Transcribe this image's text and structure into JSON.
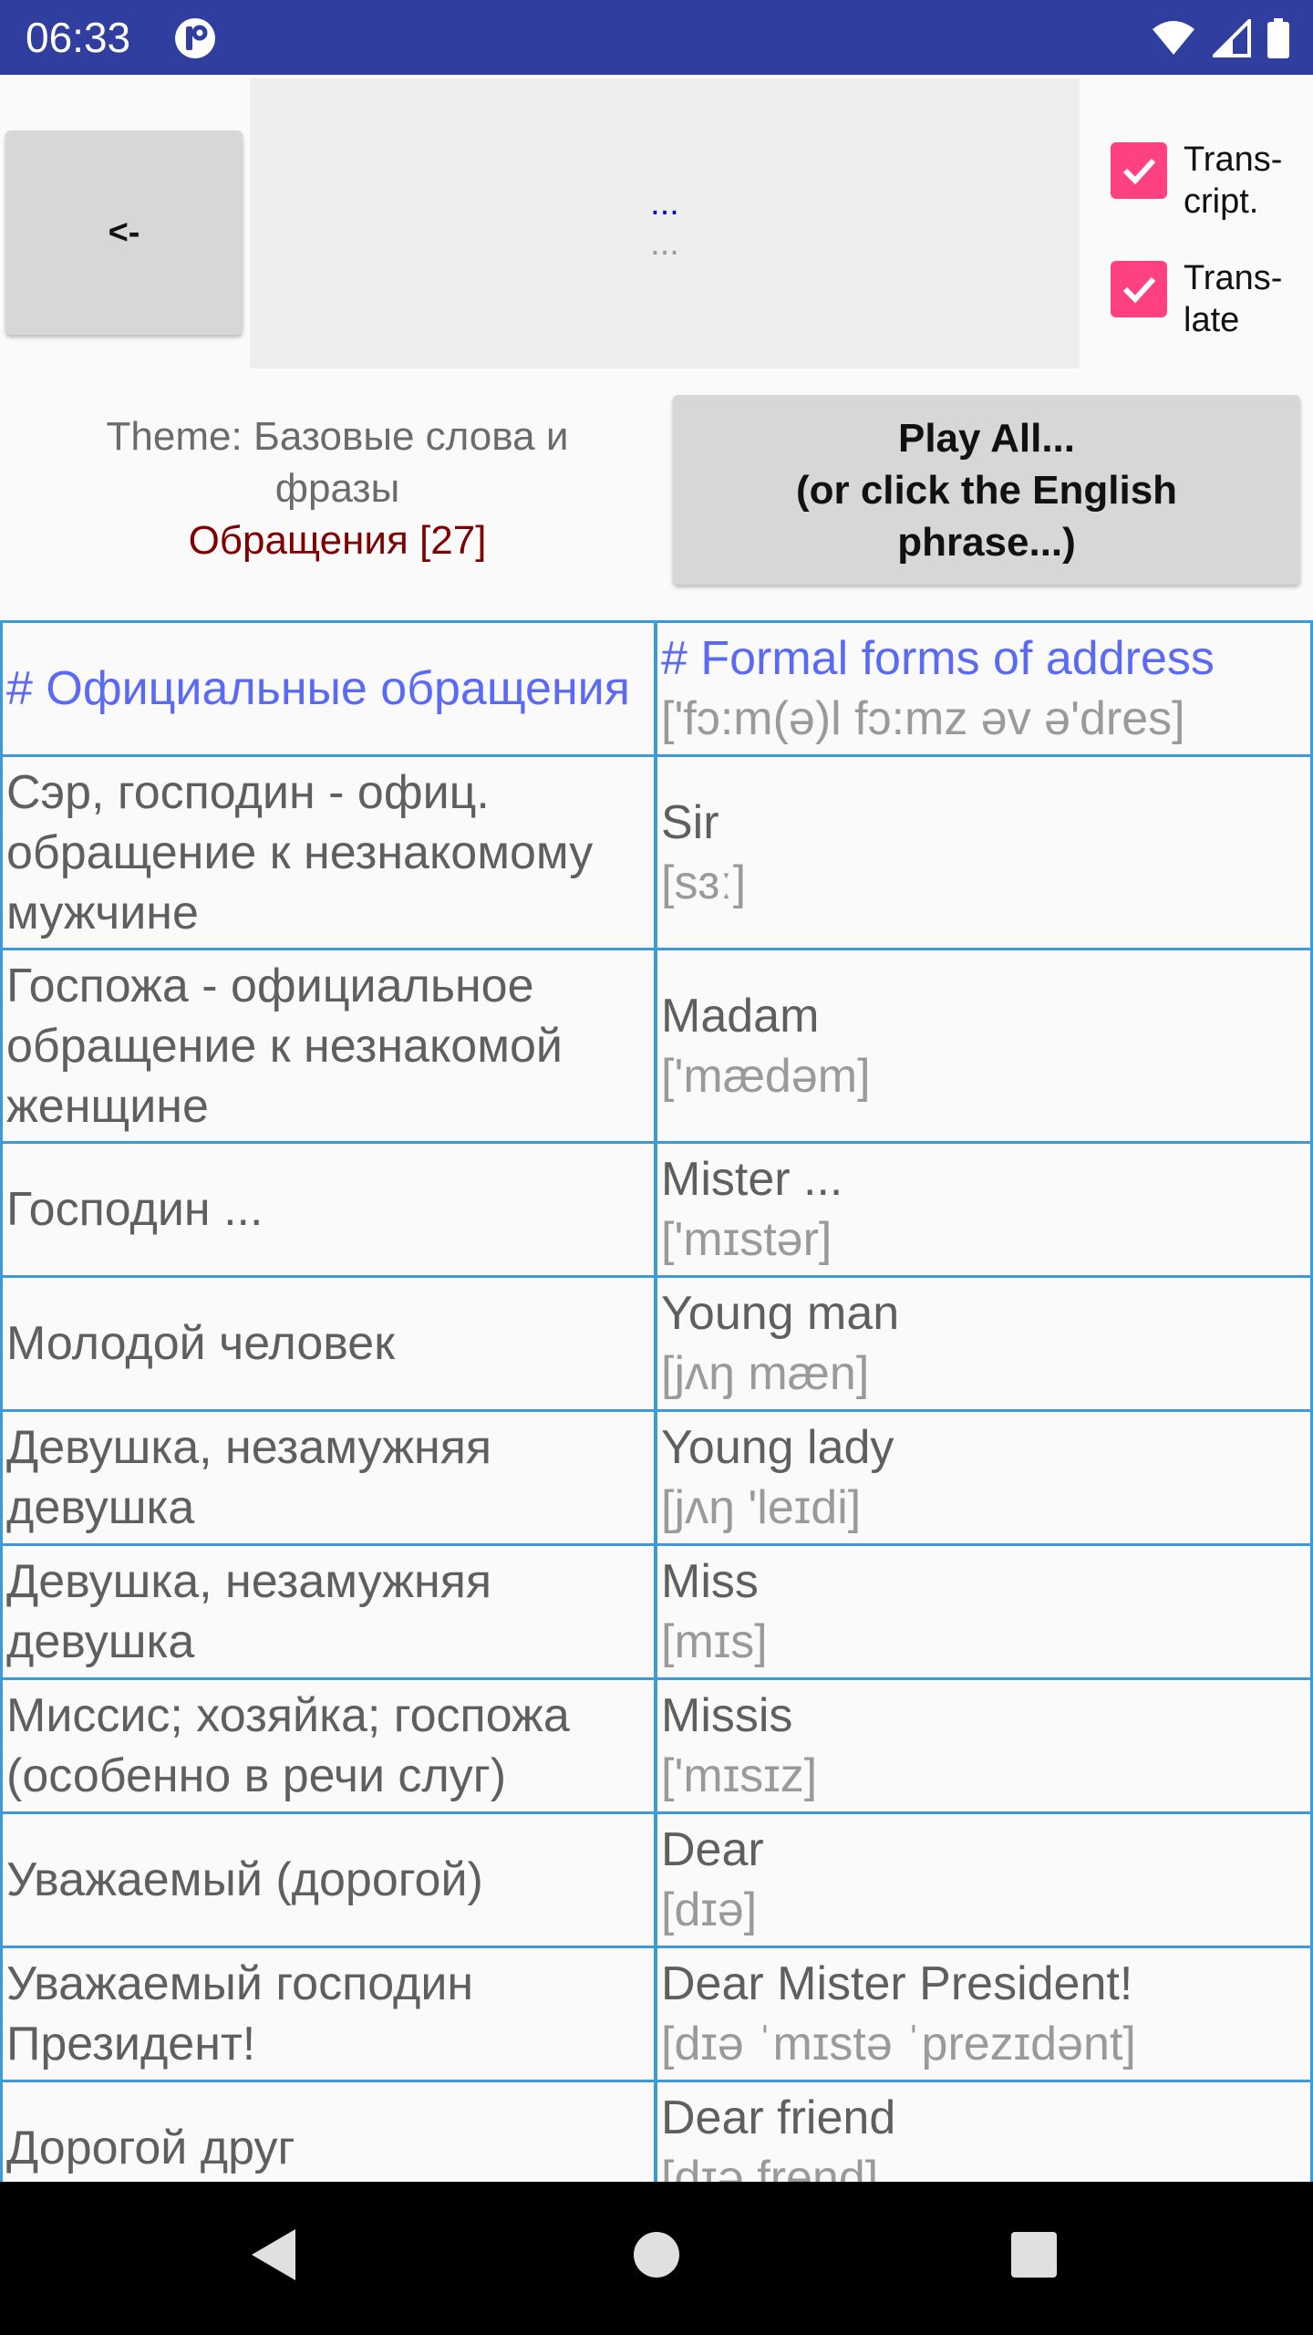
{
  "status_bar": {
    "time": "06:33",
    "icons": [
      "app-notification-icon",
      "wifi-icon",
      "signal-icon",
      "battery-icon"
    ]
  },
  "controls": {
    "back_label": "<-",
    "current_phrase": "...",
    "current_transcription": "...",
    "transcript_label": "Trans-\ncript.",
    "translate_label": "Trans-\nlate",
    "transcript_checked": true,
    "translate_checked": true,
    "play_all_label": "Play All...\n(or click the English\nphrase...)"
  },
  "theme": {
    "title": "Theme: Базовые слова и фразы",
    "subtitle": "Обращения [27]"
  },
  "colors": {
    "status_bar": "#303f9f",
    "accent": "#ff4081",
    "header_text": "#5b6af5",
    "border": "#3d9ad8",
    "subtitle": "#800000"
  },
  "rows": [
    {
      "ru": "# Официальные обращения",
      "en": "# Formal forms of address",
      "tr": "['fɔ:m(ə)l fɔ:mz əv ə'dres]",
      "header": true
    },
    {
      "ru": "Сэр, господин - офиц. обращение к незнакомому мужчине",
      "en": "Sir",
      "tr": "[sɜː]"
    },
    {
      "ru": "Госпожа - официальное обращение к незнакомой женщине",
      "en": "Madam",
      "tr": "['mædəm]"
    },
    {
      "ru": "Господин ...",
      "en": "Mister ...",
      "tr": "['mɪstər]"
    },
    {
      "ru": "Молодой человек",
      "en": "Young man",
      "tr": "[jʌŋ mæn]"
    },
    {
      "ru": "Девушка, незамужняя девушка",
      "en": "Young lady",
      "tr": "[jʌŋ 'leɪdi]"
    },
    {
      "ru": "Девушка, незамужняя девушка",
      "en": "Miss",
      "tr": "[mɪs]"
    },
    {
      "ru": "Миссис; хозяйка; госпожа (особенно в речи слуг)",
      "en": "Missis",
      "tr": "['mɪsɪz]"
    },
    {
      "ru": "Уважаемый (дорогой)",
      "en": "Dear",
      "tr": "[dɪə]"
    },
    {
      "ru": "Уважаемый господин Президент!",
      "en": "Dear Mister President!",
      "tr": "[dɪə ˈmɪstə ˈprezɪdənt]"
    },
    {
      "ru": "Дорогой друг",
      "en": "Dear friend",
      "tr": "[dɪə frend]"
    }
  ],
  "navigation": [
    "back-icon",
    "home-icon",
    "recents-icon"
  ]
}
